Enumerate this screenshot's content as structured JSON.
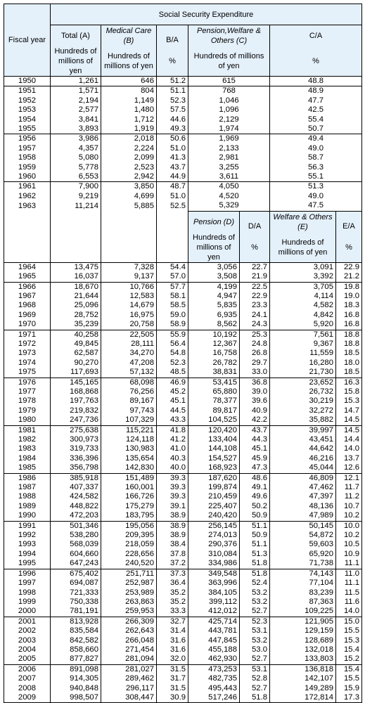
{
  "table": {
    "header": {
      "fiscal_year": "Fiscal year",
      "group_title": "Social  Security  Expenditure",
      "total": "Total (A)",
      "medical": "Medical Care (B)",
      "ba": "B/A",
      "pwo": "Pension,Welfare & Others (C)",
      "ca": "C/A",
      "unit": "Hundreds of millions of yen",
      "pct": "%",
      "pension": "Pension (D)",
      "da": "D/A",
      "welfare": "Welfare & Others (E)",
      "ea": "E/A"
    },
    "rows_early": [
      {
        "year": "1950",
        "a": "1,261",
        "b": "646",
        "ba": "51.2",
        "c": "615",
        "ca": "48.8"
      },
      {
        "year": "1951",
        "a": "1,571",
        "b": "804",
        "ba": "51.1",
        "c": "768",
        "ca": "48.9"
      },
      {
        "year": "1952",
        "a": "2,194",
        "b": "1,149",
        "ba": "52.3",
        "c": "1,046",
        "ca": "47.7"
      },
      {
        "year": "1953",
        "a": "2,577",
        "b": "1,480",
        "ba": "57.5",
        "c": "1,096",
        "ca": "42.5"
      },
      {
        "year": "1954",
        "a": "3,841",
        "b": "1,712",
        "ba": "44.6",
        "c": "2,129",
        "ca": "55.4"
      },
      {
        "year": "1955",
        "a": "3,893",
        "b": "1,919",
        "ba": "49.3",
        "c": "1,974",
        "ca": "50.7"
      },
      {
        "year": "1956",
        "a": "3,986",
        "b": "2,018",
        "ba": "50.6",
        "c": "1,969",
        "ca": "49.4"
      },
      {
        "year": "1957",
        "a": "4,357",
        "b": "2,224",
        "ba": "51.0",
        "c": "2,133",
        "ca": "49.0"
      },
      {
        "year": "1958",
        "a": "5,080",
        "b": "2,099",
        "ba": "41.3",
        "c": "2,981",
        "ca": "58.7"
      },
      {
        "year": "1959",
        "a": "5,778",
        "b": "2,523",
        "ba": "43.7",
        "c": "3,255",
        "ca": "56.3"
      },
      {
        "year": "1960",
        "a": "6,553",
        "b": "2,942",
        "ba": "44.9",
        "c": "3,611",
        "ca": "55.1"
      },
      {
        "year": "1961",
        "a": "7,900",
        "b": "3,850",
        "ba": "48.7",
        "c": "4,050",
        "ca": "51.3"
      },
      {
        "year": "1962",
        "a": "9,219",
        "b": "4,699",
        "ba": "51.0",
        "c": "4,520",
        "ca": "49.0"
      },
      {
        "year": "1963",
        "a": "11,214",
        "b": "5,885",
        "ba": "52.5",
        "c": "5,329",
        "ca": "47.5"
      }
    ],
    "rows_late": [
      {
        "year": "1964",
        "a": "13,475",
        "b": "7,328",
        "ba": "54.4",
        "d": "3,056",
        "da": "22.7",
        "e": "3,091",
        "ea": "22.9"
      },
      {
        "year": "1965",
        "a": "16,037",
        "b": "9,137",
        "ba": "57.0",
        "d": "3,508",
        "da": "21.9",
        "e": "3,392",
        "ea": "21.2"
      },
      {
        "year": "1966",
        "a": "18,670",
        "b": "10,766",
        "ba": "57.7",
        "d": "4,199",
        "da": "22.5",
        "e": "3,705",
        "ea": "19.8"
      },
      {
        "year": "1967",
        "a": "21,644",
        "b": "12,583",
        "ba": "58.1",
        "d": "4,947",
        "da": "22.9",
        "e": "4,114",
        "ea": "19.0"
      },
      {
        "year": "1968",
        "a": "25,096",
        "b": "14,679",
        "ba": "58.5",
        "d": "5,835",
        "da": "23.3",
        "e": "4,582",
        "ea": "18.3"
      },
      {
        "year": "1969",
        "a": "28,752",
        "b": "16,975",
        "ba": "59.0",
        "d": "6,935",
        "da": "24.1",
        "e": "4,842",
        "ea": "16.8"
      },
      {
        "year": "1970",
        "a": "35,239",
        "b": "20,758",
        "ba": "58.9",
        "d": "8,562",
        "da": "24.3",
        "e": "5,920",
        "ea": "16.8"
      },
      {
        "year": "1971",
        "a": "40,258",
        "b": "22,505",
        "ba": "55.9",
        "d": "10,192",
        "da": "25.3",
        "e": "7,561",
        "ea": "18.8"
      },
      {
        "year": "1972",
        "a": "49,845",
        "b": "28,111",
        "ba": "56.4",
        "d": "12,367",
        "da": "24.8",
        "e": "9,367",
        "ea": "18.8"
      },
      {
        "year": "1973",
        "a": "62,587",
        "b": "34,270",
        "ba": "54.8",
        "d": "16,758",
        "da": "26.8",
        "e": "11,559",
        "ea": "18.5"
      },
      {
        "year": "1974",
        "a": "90,270",
        "b": "47,208",
        "ba": "52.3",
        "d": "26,782",
        "da": "29.7",
        "e": "16,280",
        "ea": "18.0"
      },
      {
        "year": "1975",
        "a": "117,693",
        "b": "57,132",
        "ba": "48.5",
        "d": "38,831",
        "da": "33.0",
        "e": "21,730",
        "ea": "18.5"
      },
      {
        "year": "1976",
        "a": "145,165",
        "b": "68,098",
        "ba": "46.9",
        "d": "53,415",
        "da": "36.8",
        "e": "23,652",
        "ea": "16.3"
      },
      {
        "year": "1977",
        "a": "168,868",
        "b": "76,256",
        "ba": "45.2",
        "d": "65,880",
        "da": "39.0",
        "e": "26,732",
        "ea": "15.8"
      },
      {
        "year": "1978",
        "a": "197,763",
        "b": "89,167",
        "ba": "45.1",
        "d": "78,377",
        "da": "39.6",
        "e": "30,219",
        "ea": "15.3"
      },
      {
        "year": "1979",
        "a": "219,832",
        "b": "97,743",
        "ba": "44.5",
        "d": "89,817",
        "da": "40.9",
        "e": "32,272",
        "ea": "14.7"
      },
      {
        "year": "1980",
        "a": "247,736",
        "b": "107,329",
        "ba": "43.3",
        "d": "104,525",
        "da": "42.2",
        "e": "35,882",
        "ea": "14.5"
      },
      {
        "year": "1981",
        "a": "275,638",
        "b": "115,221",
        "ba": "41.8",
        "d": "120,420",
        "da": "43.7",
        "e": "39,997",
        "ea": "14.5"
      },
      {
        "year": "1982",
        "a": "300,973",
        "b": "124,118",
        "ba": "41.2",
        "d": "133,404",
        "da": "44.3",
        "e": "43,451",
        "ea": "14.4"
      },
      {
        "year": "1983",
        "a": "319,733",
        "b": "130,983",
        "ba": "41.0",
        "d": "144,108",
        "da": "45.1",
        "e": "44,642",
        "ea": "14.0"
      },
      {
        "year": "1984",
        "a": "336,396",
        "b": "135,654",
        "ba": "40.3",
        "d": "154,527",
        "da": "45.9",
        "e": "46,216",
        "ea": "13.7"
      },
      {
        "year": "1985",
        "a": "356,798",
        "b": "142,830",
        "ba": "40.0",
        "d": "168,923",
        "da": "47.3",
        "e": "45,044",
        "ea": "12.6"
      },
      {
        "year": "1986",
        "a": "385,918",
        "b": "151,489",
        "ba": "39.3",
        "d": "187,620",
        "da": "48.6",
        "e": "46,809",
        "ea": "12.1"
      },
      {
        "year": "1987",
        "a": "407,337",
        "b": "160,001",
        "ba": "39.3",
        "d": "199,874",
        "da": "49.1",
        "e": "47,462",
        "ea": "11.7"
      },
      {
        "year": "1988",
        "a": "424,582",
        "b": "166,726",
        "ba": "39.3",
        "d": "210,459",
        "da": "49.6",
        "e": "47,397",
        "ea": "11.2"
      },
      {
        "year": "1989",
        "a": "448,822",
        "b": "175,279",
        "ba": "39.1",
        "d": "225,407",
        "da": "50.2",
        "e": "48,136",
        "ea": "10.7"
      },
      {
        "year": "1990",
        "a": "472,203",
        "b": "183,795",
        "ba": "38.9",
        "d": "240,420",
        "da": "50.9",
        "e": "47,989",
        "ea": "10.2"
      },
      {
        "year": "1991",
        "a": "501,346",
        "b": "195,056",
        "ba": "38.9",
        "d": "256,145",
        "da": "51.1",
        "e": "50,145",
        "ea": "10.0"
      },
      {
        "year": "1992",
        "a": "538,280",
        "b": "209,395",
        "ba": "38.9",
        "d": "274,013",
        "da": "50.9",
        "e": "54,872",
        "ea": "10.2"
      },
      {
        "year": "1993",
        "a": "568,039",
        "b": "218,059",
        "ba": "38.4",
        "d": "290,376",
        "da": "51.1",
        "e": "59,603",
        "ea": "10.5"
      },
      {
        "year": "1994",
        "a": "604,660",
        "b": "228,656",
        "ba": "37.8",
        "d": "310,084",
        "da": "51.3",
        "e": "65,920",
        "ea": "10.9"
      },
      {
        "year": "1995",
        "a": "647,243",
        "b": "240,520",
        "ba": "37.2",
        "d": "334,986",
        "da": "51.8",
        "e": "71,738",
        "ea": "11.1"
      },
      {
        "year": "1996",
        "a": "675,402",
        "b": "251,711",
        "ba": "37.3",
        "d": "349,548",
        "da": "51.8",
        "e": "74,143",
        "ea": "11.0"
      },
      {
        "year": "1997",
        "a": "694,087",
        "b": "252,987",
        "ba": "36.4",
        "d": "363,996",
        "da": "52.4",
        "e": "77,104",
        "ea": "11.1"
      },
      {
        "year": "1998",
        "a": "721,333",
        "b": "253,989",
        "ba": "35.2",
        "d": "384,105",
        "da": "53.2",
        "e": "83,239",
        "ea": "11.5"
      },
      {
        "year": "1999",
        "a": "750,338",
        "b": "263,863",
        "ba": "35.2",
        "d": "399,112",
        "da": "53.2",
        "e": "87,363",
        "ea": "11.6"
      },
      {
        "year": "2000",
        "a": "781,191",
        "b": "259,953",
        "ba": "33.3",
        "d": "412,012",
        "da": "52.7",
        "e": "109,225",
        "ea": "14.0"
      },
      {
        "year": "2001",
        "a": "813,928",
        "b": "266,309",
        "ba": "32.7",
        "d": "425,714",
        "da": "52.3",
        "e": "121,905",
        "ea": "15.0"
      },
      {
        "year": "2002",
        "a": "835,584",
        "b": "262,643",
        "ba": "31.4",
        "d": "443,781",
        "da": "53.1",
        "e": "129,159",
        "ea": "15.5"
      },
      {
        "year": "2003",
        "a": "842,582",
        "b": "266,048",
        "ba": "31.6",
        "d": "447,845",
        "da": "53.2",
        "e": "128,689",
        "ea": "15.3"
      },
      {
        "year": "2004",
        "a": "858,660",
        "b": "271,454",
        "ba": "31.6",
        "d": "455,188",
        "da": "53.0",
        "e": "132,018",
        "ea": "15.4"
      },
      {
        "year": "2005",
        "a": "877,827",
        "b": "281,094",
        "ba": "32.0",
        "d": "462,930",
        "da": "52.7",
        "e": "133,803",
        "ea": "15.2"
      },
      {
        "year": "2006",
        "a": "891,098",
        "b": "281,027",
        "ba": "31.5",
        "d": "473,253",
        "da": "53.1",
        "e": "136,818",
        "ea": "15.4"
      },
      {
        "year": "2007",
        "a": "914,305",
        "b": "289,462",
        "ba": "31.7",
        "d": "482,735",
        "da": "52.8",
        "e": "142,107",
        "ea": "15.5"
      },
      {
        "year": "2008",
        "a": "940,848",
        "b": "296,117",
        "ba": "31.5",
        "d": "495,443",
        "da": "52.7",
        "e": "149,289",
        "ea": "15.9"
      },
      {
        "year": "2009",
        "a": "998,507",
        "b": "308,447",
        "ba": "30.9",
        "d": "517,246",
        "da": "51.8",
        "e": "172,814",
        "ea": "17.3"
      }
    ]
  }
}
